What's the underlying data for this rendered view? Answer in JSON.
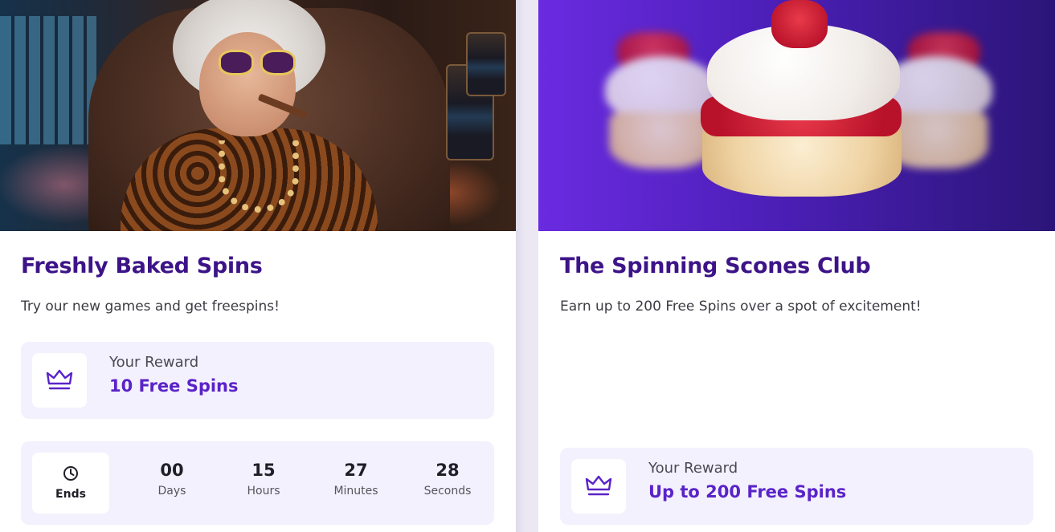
{
  "promotions": [
    {
      "title": "Freshly Baked Spins",
      "description": "Try our new games and get freespins!",
      "reward": {
        "label": "Your Reward",
        "value": "10 Free Spins"
      },
      "timer": {
        "ends_label": "Ends",
        "days": {
          "value": "00",
          "unit": "Days"
        },
        "hours": {
          "value": "15",
          "unit": "Hours"
        },
        "minutes": {
          "value": "27",
          "unit": "Minutes"
        },
        "seconds": {
          "value": "28",
          "unit": "Seconds"
        }
      }
    },
    {
      "title": "The Spinning Scones Club",
      "description": "Earn up to 200 Free Spins over a spot of excitement!",
      "reward": {
        "label": "Your Reward",
        "value": "Up to 200 Free Spins"
      }
    }
  ],
  "icons": {
    "reward": "crown-icon",
    "timer": "clock-icon"
  },
  "colors": {
    "title": "#3d1488",
    "accent": "#5a23c8",
    "panel": "#f3f1fd"
  }
}
